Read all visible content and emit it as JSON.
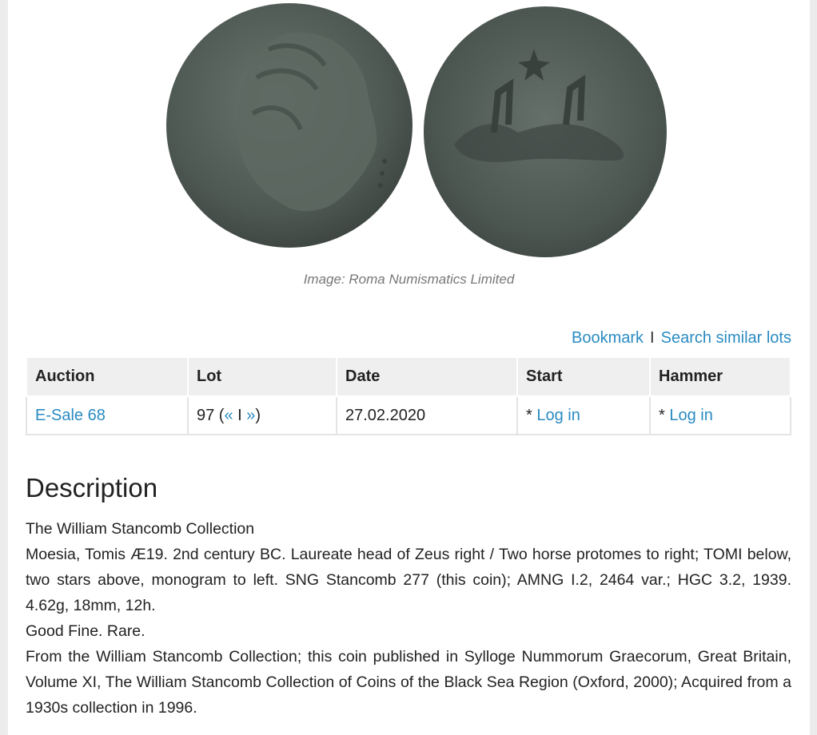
{
  "image": {
    "obverse_icon": "coin-obverse-zeus",
    "reverse_icon": "coin-reverse-horse-protomes",
    "credit": "Image: Roma Numismatics Limited"
  },
  "actions": {
    "bookmark": "Bookmark",
    "separator": "I",
    "search_similar": "Search similar lots"
  },
  "table": {
    "headers": {
      "auction": "Auction",
      "lot": "Lot",
      "date": "Date",
      "start": "Start",
      "hammer": "Hammer"
    },
    "row": {
      "auction": "E-Sale 68",
      "lot_number": "97",
      "lot_prev": "«",
      "lot_sep": "I",
      "lot_next": "»",
      "date": "27.02.2020",
      "start_prefix": "*",
      "start_link": "Log in",
      "hammer_prefix": "*",
      "hammer_link": "Log in"
    }
  },
  "description": {
    "title": "Description",
    "lines": [
      "The William Stancomb Collection",
      "Moesia, Tomis Æ19. 2nd century BC. Laureate head of Zeus right / Two horse protomes to right; TOMI below, two stars above, monogram to left. SNG Stancomb 277 (this coin); AMNG I.2, 2464 var.; HGC 3.2, 1939. 4.62g, 18mm, 12h.",
      "Good Fine. Rare.",
      "From the William Stancomb Collection; this coin published in Sylloge Nummorum Graecorum, Great Britain, Volume XI, The William Stancomb Collection of Coins of the Black Sea Region (Oxford, 2000); Acquired from a 1930s collection in 1996."
    ]
  },
  "colors": {
    "link": "#2a8bc2",
    "header_bg": "#efefef",
    "coin": "#4f5a55"
  }
}
